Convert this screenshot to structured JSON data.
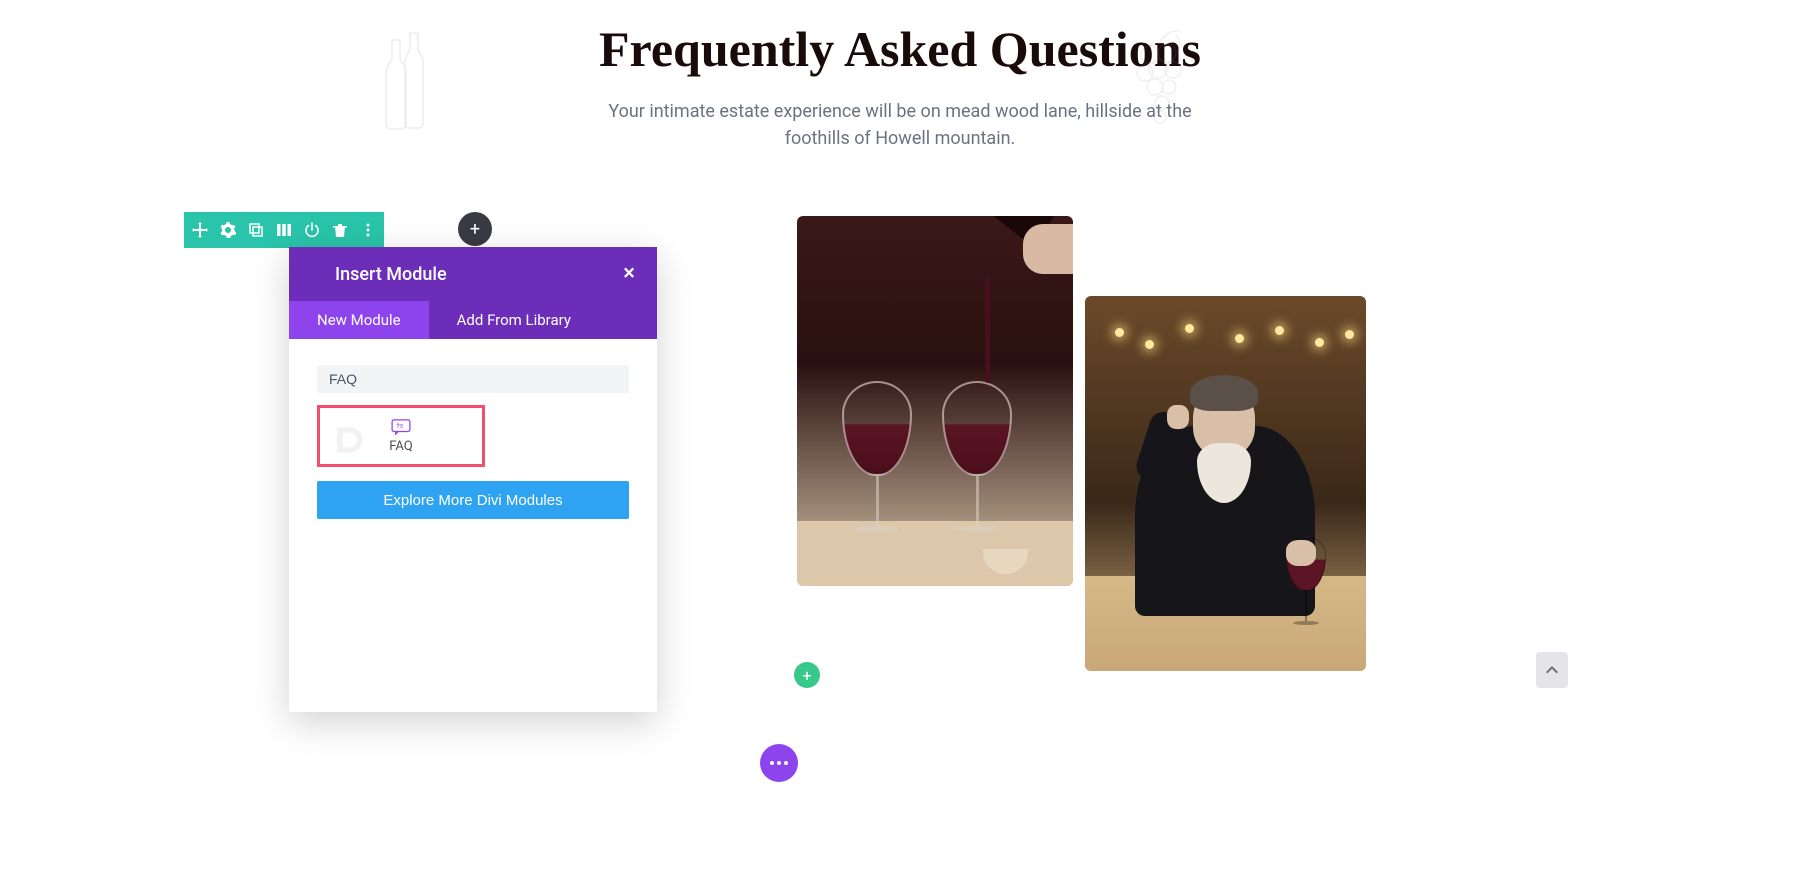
{
  "header": {
    "title": "Frequently Asked Questions",
    "subtitle": "Your intimate estate experience will be on mead wood lane, hillside at the foothills of Howell mountain."
  },
  "toolbar": {
    "icons": [
      "move",
      "gear",
      "duplicate",
      "columns",
      "power",
      "trash",
      "more"
    ]
  },
  "add_button_dark": "+",
  "modal": {
    "title": "Insert Module",
    "close": "×",
    "tabs": {
      "new_module": "New Module",
      "add_from_library": "Add From Library"
    },
    "search_value": "FAQ",
    "module": {
      "label": "FAQ"
    },
    "explore_button": "Explore More Divi Modules"
  },
  "green_add": "+",
  "colors": {
    "toolbar": "#29c4a9",
    "modal_header": "#6c2eb9",
    "tab_active": "#8e44ec",
    "explore_btn": "#2ea3f2",
    "highlight_border": "#f0506e",
    "green_add": "#37c989"
  }
}
